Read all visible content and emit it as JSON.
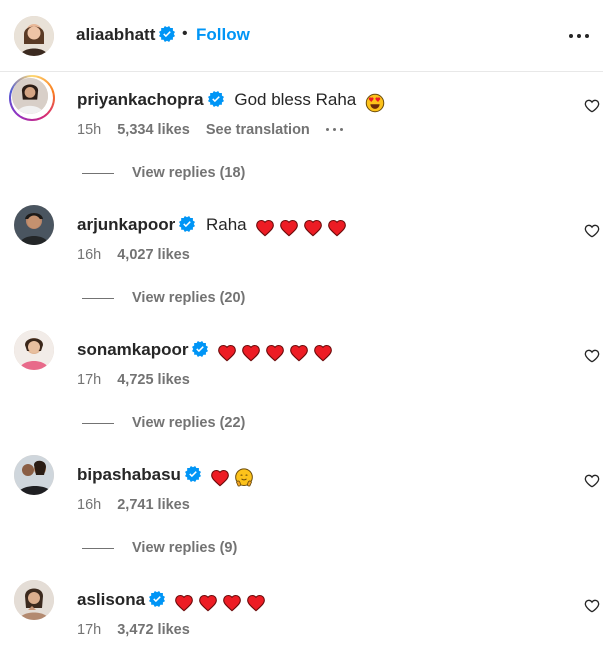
{
  "post": {
    "owner": "aliaabhatt",
    "separator": "•",
    "follow_label": "Follow"
  },
  "comments": [
    {
      "username": "priyankachopra",
      "text": "God bless Raha",
      "emoji": [
        "heart-eyes"
      ],
      "time": "15h",
      "likes": "5,334 likes",
      "translate": "See translation",
      "replies": "View replies (18)"
    },
    {
      "username": "arjunkapoor",
      "text": "Raha",
      "emoji": [
        "heart",
        "heart",
        "heart",
        "heart"
      ],
      "time": "16h",
      "likes": "4,027 likes",
      "replies": "View replies (20)"
    },
    {
      "username": "sonamkapoor",
      "text": "",
      "emoji": [
        "heart",
        "heart",
        "heart",
        "heart",
        "heart"
      ],
      "time": "17h",
      "likes": "4,725 likes",
      "replies": "View replies (22)"
    },
    {
      "username": "bipashabasu",
      "text": "",
      "emoji": [
        "heart",
        "hug"
      ],
      "time": "16h",
      "likes": "2,741 likes",
      "replies": "View replies (9)"
    },
    {
      "username": "aslisona",
      "text": "",
      "emoji": [
        "heart",
        "heart",
        "heart",
        "heart"
      ],
      "time": "17h",
      "likes": "3,472 likes"
    }
  ],
  "colors": {
    "accent": "#0095f6",
    "verified": "#0095f6",
    "heart": "#ed1c24",
    "muted": "#737373"
  }
}
